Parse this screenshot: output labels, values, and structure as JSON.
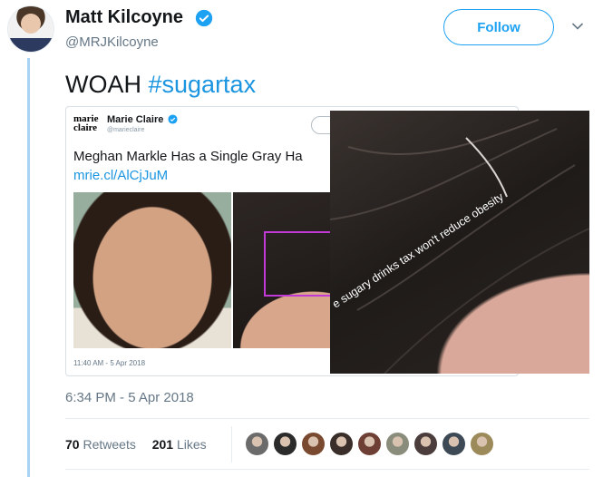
{
  "tweet": {
    "author_name": "Matt Kilcoyne",
    "author_handle": "@MRJKilcoyne",
    "follow_label": "Follow",
    "text_prefix": "WOAH ",
    "hashtag": "#sugartax",
    "timestamp": "6:34 PM - 5 Apr 2018",
    "retweet_count": "70",
    "retweet_label": "Retweets",
    "like_count": "201",
    "like_label": "Likes"
  },
  "embedded": {
    "logo_text": "marie claire",
    "account_name": "Marie Claire",
    "account_handle": "@marieclaire",
    "text": "Meghan Markle Has a Single Gray Ha",
    "link": "mrie.cl/AlCjJuM",
    "time": "11:40 AM - 5 Apr 2018"
  },
  "overlay": {
    "caption": "e sugary drinks tax won't reduce obesity"
  },
  "likers": [
    {
      "icon": "liker-avatar",
      "color": "#6b6b6b"
    },
    {
      "icon": "liker-avatar",
      "color": "#2b2b2b"
    },
    {
      "icon": "liker-avatar",
      "color": "#7a4a30"
    },
    {
      "icon": "liker-avatar",
      "color": "#3a2e2a"
    },
    {
      "icon": "liker-avatar",
      "color": "#6e3f35"
    },
    {
      "icon": "liker-avatar",
      "color": "#8a8d7c"
    },
    {
      "icon": "liker-avatar",
      "color": "#4a3d3b"
    },
    {
      "icon": "liker-avatar",
      "color": "#3d4a55"
    },
    {
      "icon": "liker-avatar",
      "color": "#9c8a5a"
    }
  ],
  "colors": {
    "accent": "#1da1f2",
    "hashtag": "#1b95e0",
    "thread_line": "#a9d3f2",
    "highlight_box": "#c13ad6"
  }
}
